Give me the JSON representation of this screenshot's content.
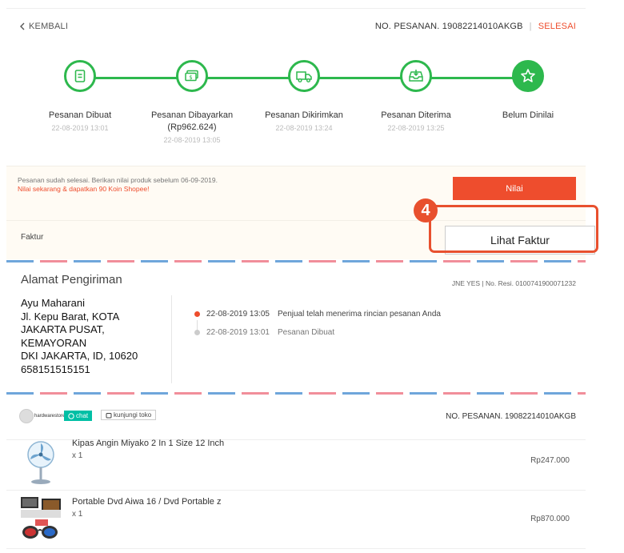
{
  "header": {
    "back_label": "KEMBALI",
    "order_label": "NO. PESANAN. 19082214010AKGB",
    "separator": "|",
    "status": "SELESAI"
  },
  "steps": [
    {
      "label": "Pesanan Dibuat",
      "sub": "",
      "date": "22-08-2019 13:01",
      "icon": "receipt-icon"
    },
    {
      "label": "Pesanan Dibayarkan",
      "sub": "(Rp962.624)",
      "date": "22-08-2019 13:05",
      "icon": "money-icon"
    },
    {
      "label": "Pesanan Dikirimkan",
      "sub": "",
      "date": "22-08-2019 13:24",
      "icon": "truck-icon"
    },
    {
      "label": "Pesanan Diterima",
      "sub": "",
      "date": "22-08-2019 13:25",
      "icon": "inbox-download-icon"
    },
    {
      "label": "Belum Dinilai",
      "sub": "",
      "date": "",
      "icon": "star-icon"
    }
  ],
  "notice": {
    "line1": "Pesanan sudah selesai. Berikan nilai produk sebelum 06-09-2019.",
    "line2": "Nilai sekarang & dapatkan 90 Koin Shopee!",
    "button": "Nilai"
  },
  "faktur": {
    "label": "Faktur",
    "button": "Lihat Faktur",
    "annotation_number": "4"
  },
  "address": {
    "title": "Alamat Pengiriman",
    "courier": "JNE YES | No. Resi. 0100741900071232",
    "lines": [
      "Ayu Maharani",
      "Jl. Kepu Barat, KOTA",
      "JAKARTA PUSAT,",
      "KEMAYORAN",
      "DKI JAKARTA, ID, 10620",
      "658151515151"
    ]
  },
  "logs": [
    {
      "time": "22-08-2019 13:05",
      "text": "Penjual telah menerima rincian pesanan Anda"
    },
    {
      "time": "22-08-2019 13:01",
      "text": "Pesanan Dibuat"
    }
  ],
  "shop": {
    "name": "hardwarestore",
    "chat": "chat",
    "visit": "kunjungi toko",
    "order_label": "NO. PESANAN. 19082214010AKGB"
  },
  "items": [
    {
      "name": "Kipas Angin Miyako 2 In 1 Size 12 Inch",
      "qty": "x 1",
      "price": "Rp247.000"
    },
    {
      "name": "Portable Dvd Aiwa 16 / Dvd Portable z",
      "qty": "x 1",
      "price": "Rp870.000"
    }
  ],
  "colors": {
    "accent": "#ee4d2d",
    "progress": "#2db84d",
    "highlight": "#e8502e",
    "chat": "#00bfa5"
  }
}
